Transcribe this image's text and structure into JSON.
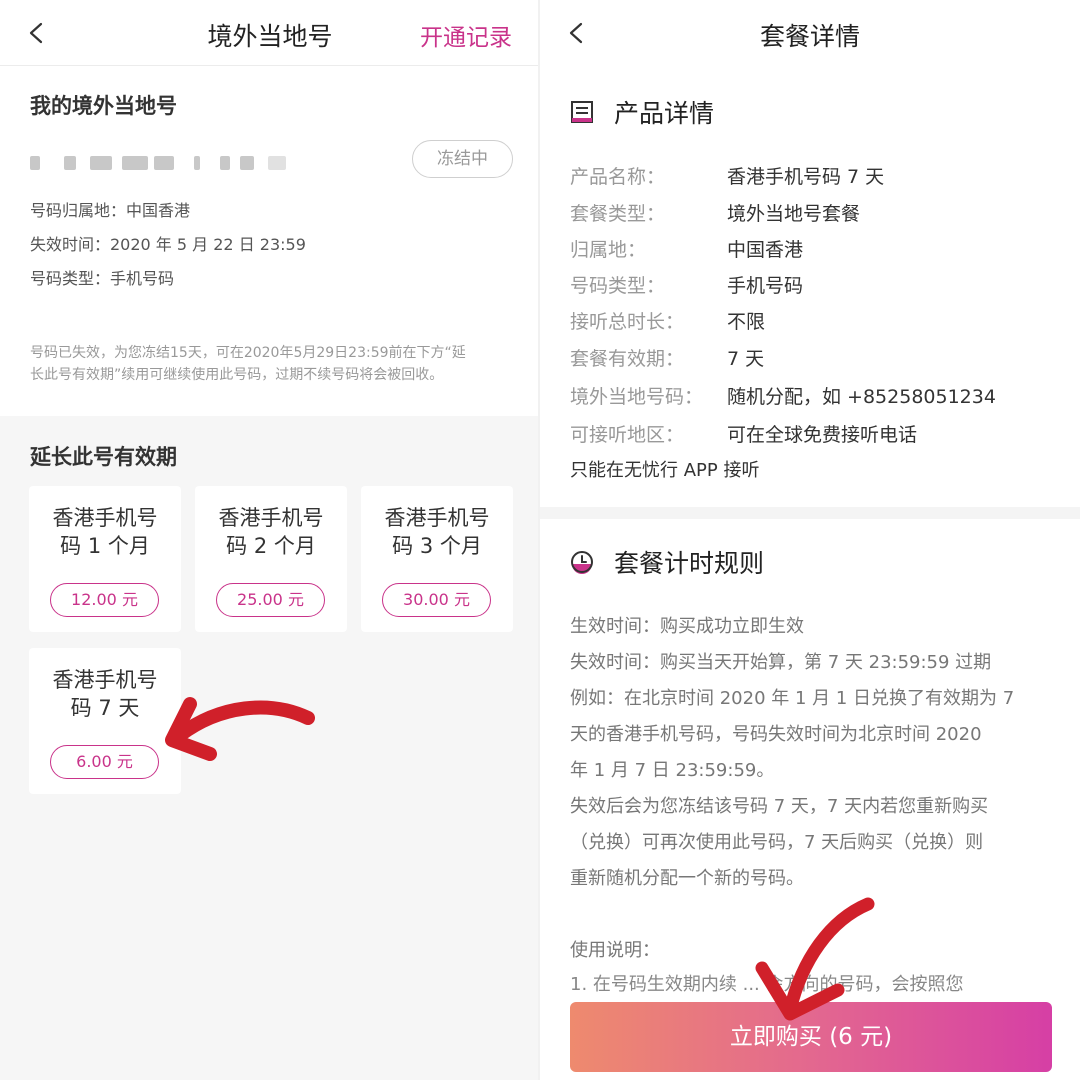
{
  "left": {
    "header": {
      "title": "境外当地号",
      "action": "开通记录"
    },
    "my_number": {
      "title": "我的境外当地号",
      "status_badge": "冻结中",
      "info": [
        "号码归属地：中国香港",
        "失效时间：2020 年 5 月 22 日 23:59",
        "号码类型：手机号码"
      ],
      "notice_lines": [
        "号码已失效，为您冻结15天，可在2020年5月29日23:59前在下方“延",
        "长此号有效期”续用可继续使用此号码，过期不续号码将会被回收。"
      ]
    },
    "extend": {
      "title": "延长此号有效期",
      "packages": [
        {
          "name_lines": [
            "香港手机号",
            "码 1 个月"
          ],
          "price": "12.00 元"
        },
        {
          "name_lines": [
            "香港手机号",
            "码 2 个月"
          ],
          "price": "25.00 元"
        },
        {
          "name_lines": [
            "香港手机号",
            "码 3 个月"
          ],
          "price": "30.00 元"
        },
        {
          "name_lines": [
            "香港手机号",
            "码 7 天"
          ],
          "price": "6.00 元"
        }
      ]
    }
  },
  "right": {
    "header": {
      "title": "套餐详情"
    },
    "product": {
      "title": "产品详情",
      "rows": [
        {
          "label": "产品名称：",
          "value": "香港手机号码 7 天"
        },
        {
          "label": "套餐类型：",
          "value": "境外当地号套餐"
        },
        {
          "label": "归属地：",
          "value": "中国香港"
        },
        {
          "label": "号码类型：",
          "value": "手机号码"
        },
        {
          "label": "接听总时长：",
          "value": "不限"
        },
        {
          "label": "套餐有效期：",
          "value": "7 天"
        },
        {
          "label": "境外当地号码：",
          "value": "随机分配，如 +85258051234"
        },
        {
          "label": "可接听地区：",
          "value": "可在全球免费接听电话"
        }
      ],
      "note": "只能在无忧行 APP 接听"
    },
    "rules": {
      "title": "套餐计时规则",
      "lines": [
        "生效时间：购买成功立即生效",
        "失效时间：购买当天开始算，第 7 天 23:59:59 过期",
        "例如：在北京时间 2020 年 1 月 1 日兑换了有效期为 7",
        "天的香港手机号码，号码失效时间为北京时间 2020",
        "年 1 月 7 日 23:59:59。",
        "失效后会为您冻结该号码 7 天，7 天内若您重新购买",
        "（兑换）可再次使用此号码，7 天后购买（兑换）则",
        "重新随机分配一个新的号码。"
      ],
      "usage_title": "使用说明：",
      "usage_partial": "1. 在号码生效期内续 ... 会方向的号码，会按照您"
    },
    "buy_button": "立即购买 (6 元)"
  },
  "colors": {
    "accent": "#c9338a",
    "annotation_arrow": "#d0202a"
  }
}
